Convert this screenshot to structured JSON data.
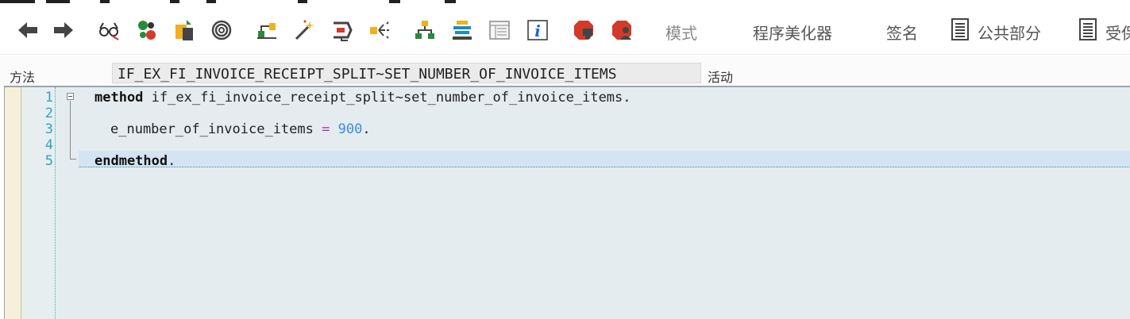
{
  "toolbar": {
    "icons": [
      "back-arrow-icon",
      "forward-arrow-icon",
      "glasses-icon",
      "refresh-icon",
      "clipboard-icon",
      "spiral-icon",
      "hierarchy-icon",
      "magic-wand-icon",
      "display-icon",
      "split-arrows-icon",
      "tree-icon",
      "stack-icon",
      "frame-icon",
      "info-icon",
      "stop-icon",
      "stop-user-icon"
    ],
    "mode_label": "模式",
    "pretty_printer_label": "程序美化器",
    "signature_label": "签名",
    "public_section_label": "公共部分",
    "protected_section_label": "受保"
  },
  "method_row": {
    "label": "方法",
    "value": "IF_EX_FI_INVOICE_RECEIPT_SPLIT~SET_NUMBER_OF_INVOICE_ITEMS",
    "status": "活动"
  },
  "editor": {
    "line_numbers": [
      "1",
      "2",
      "3",
      "4",
      "5"
    ],
    "line1": {
      "keyword": "method",
      "rest": " if_ex_fi_invoice_receipt_split~set_number_of_invoice_items."
    },
    "line3": {
      "var": "e_number_of_invoice_items",
      "op": "=",
      "value": "900",
      "end": "."
    },
    "line5": {
      "keyword": "endmethod",
      "end": "."
    }
  },
  "colors": {
    "editor_bg": "#e4ecef",
    "line_number": "#3aa0b4",
    "number_literal": "#3a8ee0",
    "operator": "#a83aa0"
  }
}
